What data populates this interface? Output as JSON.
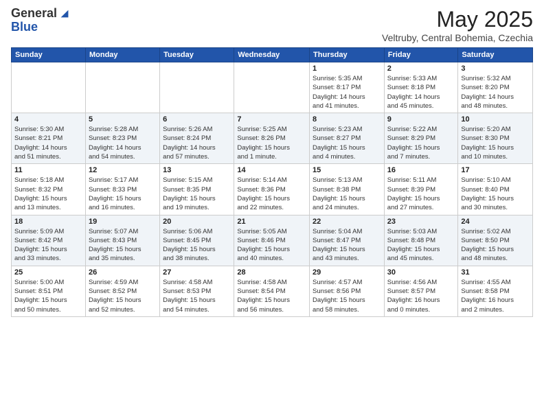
{
  "header": {
    "logo_general": "General",
    "logo_blue": "Blue",
    "month": "May 2025",
    "location": "Veltruby, Central Bohemia, Czechia"
  },
  "days_of_week": [
    "Sunday",
    "Monday",
    "Tuesday",
    "Wednesday",
    "Thursday",
    "Friday",
    "Saturday"
  ],
  "weeks": [
    [
      {
        "day": "",
        "info": ""
      },
      {
        "day": "",
        "info": ""
      },
      {
        "day": "",
        "info": ""
      },
      {
        "day": "",
        "info": ""
      },
      {
        "day": "1",
        "info": "Sunrise: 5:35 AM\nSunset: 8:17 PM\nDaylight: 14 hours\nand 41 minutes."
      },
      {
        "day": "2",
        "info": "Sunrise: 5:33 AM\nSunset: 8:18 PM\nDaylight: 14 hours\nand 45 minutes."
      },
      {
        "day": "3",
        "info": "Sunrise: 5:32 AM\nSunset: 8:20 PM\nDaylight: 14 hours\nand 48 minutes."
      }
    ],
    [
      {
        "day": "4",
        "info": "Sunrise: 5:30 AM\nSunset: 8:21 PM\nDaylight: 14 hours\nand 51 minutes."
      },
      {
        "day": "5",
        "info": "Sunrise: 5:28 AM\nSunset: 8:23 PM\nDaylight: 14 hours\nand 54 minutes."
      },
      {
        "day": "6",
        "info": "Sunrise: 5:26 AM\nSunset: 8:24 PM\nDaylight: 14 hours\nand 57 minutes."
      },
      {
        "day": "7",
        "info": "Sunrise: 5:25 AM\nSunset: 8:26 PM\nDaylight: 15 hours\nand 1 minute."
      },
      {
        "day": "8",
        "info": "Sunrise: 5:23 AM\nSunset: 8:27 PM\nDaylight: 15 hours\nand 4 minutes."
      },
      {
        "day": "9",
        "info": "Sunrise: 5:22 AM\nSunset: 8:29 PM\nDaylight: 15 hours\nand 7 minutes."
      },
      {
        "day": "10",
        "info": "Sunrise: 5:20 AM\nSunset: 8:30 PM\nDaylight: 15 hours\nand 10 minutes."
      }
    ],
    [
      {
        "day": "11",
        "info": "Sunrise: 5:18 AM\nSunset: 8:32 PM\nDaylight: 15 hours\nand 13 minutes."
      },
      {
        "day": "12",
        "info": "Sunrise: 5:17 AM\nSunset: 8:33 PM\nDaylight: 15 hours\nand 16 minutes."
      },
      {
        "day": "13",
        "info": "Sunrise: 5:15 AM\nSunset: 8:35 PM\nDaylight: 15 hours\nand 19 minutes."
      },
      {
        "day": "14",
        "info": "Sunrise: 5:14 AM\nSunset: 8:36 PM\nDaylight: 15 hours\nand 22 minutes."
      },
      {
        "day": "15",
        "info": "Sunrise: 5:13 AM\nSunset: 8:38 PM\nDaylight: 15 hours\nand 24 minutes."
      },
      {
        "day": "16",
        "info": "Sunrise: 5:11 AM\nSunset: 8:39 PM\nDaylight: 15 hours\nand 27 minutes."
      },
      {
        "day": "17",
        "info": "Sunrise: 5:10 AM\nSunset: 8:40 PM\nDaylight: 15 hours\nand 30 minutes."
      }
    ],
    [
      {
        "day": "18",
        "info": "Sunrise: 5:09 AM\nSunset: 8:42 PM\nDaylight: 15 hours\nand 33 minutes."
      },
      {
        "day": "19",
        "info": "Sunrise: 5:07 AM\nSunset: 8:43 PM\nDaylight: 15 hours\nand 35 minutes."
      },
      {
        "day": "20",
        "info": "Sunrise: 5:06 AM\nSunset: 8:45 PM\nDaylight: 15 hours\nand 38 minutes."
      },
      {
        "day": "21",
        "info": "Sunrise: 5:05 AM\nSunset: 8:46 PM\nDaylight: 15 hours\nand 40 minutes."
      },
      {
        "day": "22",
        "info": "Sunrise: 5:04 AM\nSunset: 8:47 PM\nDaylight: 15 hours\nand 43 minutes."
      },
      {
        "day": "23",
        "info": "Sunrise: 5:03 AM\nSunset: 8:48 PM\nDaylight: 15 hours\nand 45 minutes."
      },
      {
        "day": "24",
        "info": "Sunrise: 5:02 AM\nSunset: 8:50 PM\nDaylight: 15 hours\nand 48 minutes."
      }
    ],
    [
      {
        "day": "25",
        "info": "Sunrise: 5:00 AM\nSunset: 8:51 PM\nDaylight: 15 hours\nand 50 minutes."
      },
      {
        "day": "26",
        "info": "Sunrise: 4:59 AM\nSunset: 8:52 PM\nDaylight: 15 hours\nand 52 minutes."
      },
      {
        "day": "27",
        "info": "Sunrise: 4:58 AM\nSunset: 8:53 PM\nDaylight: 15 hours\nand 54 minutes."
      },
      {
        "day": "28",
        "info": "Sunrise: 4:58 AM\nSunset: 8:54 PM\nDaylight: 15 hours\nand 56 minutes."
      },
      {
        "day": "29",
        "info": "Sunrise: 4:57 AM\nSunset: 8:56 PM\nDaylight: 15 hours\nand 58 minutes."
      },
      {
        "day": "30",
        "info": "Sunrise: 4:56 AM\nSunset: 8:57 PM\nDaylight: 16 hours\nand 0 minutes."
      },
      {
        "day": "31",
        "info": "Sunrise: 4:55 AM\nSunset: 8:58 PM\nDaylight: 16 hours\nand 2 minutes."
      }
    ]
  ]
}
